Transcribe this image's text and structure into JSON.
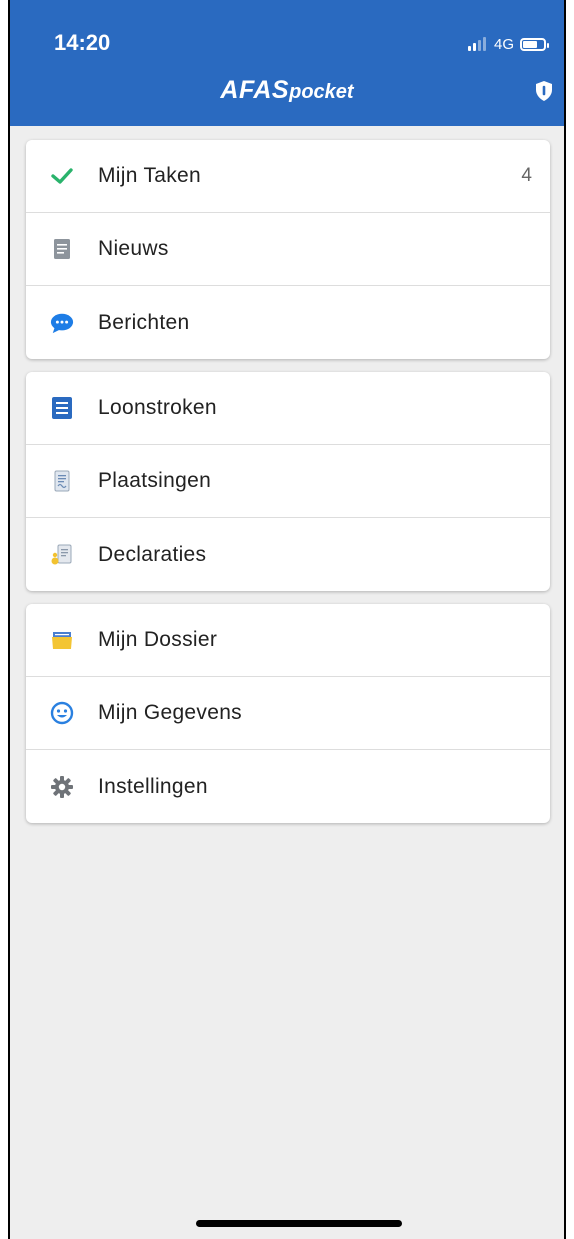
{
  "status_bar": {
    "time": "14:20",
    "network": "4G"
  },
  "app": {
    "logo_main": "AFAS",
    "logo_sub": "pocket"
  },
  "colors": {
    "header": "#2a6ac0",
    "check": "#2ab36c",
    "chat": "#1e7de6",
    "document": "#2a6ac0"
  },
  "groups": [
    [
      {
        "label": "Mijn Taken",
        "icon": "check-icon",
        "count": "4"
      },
      {
        "label": "Nieuws",
        "icon": "news-icon"
      },
      {
        "label": "Berichten",
        "icon": "chat-icon"
      }
    ],
    [
      {
        "label": "Loonstroken",
        "icon": "payslip-icon"
      },
      {
        "label": "Plaatsingen",
        "icon": "placement-icon"
      },
      {
        "label": "Declaraties",
        "icon": "expense-icon"
      }
    ],
    [
      {
        "label": "Mijn Dossier",
        "icon": "folder-icon"
      },
      {
        "label": "Mijn Gegevens",
        "icon": "smiley-icon"
      },
      {
        "label": "Instellingen",
        "icon": "gear-icon"
      }
    ]
  ]
}
